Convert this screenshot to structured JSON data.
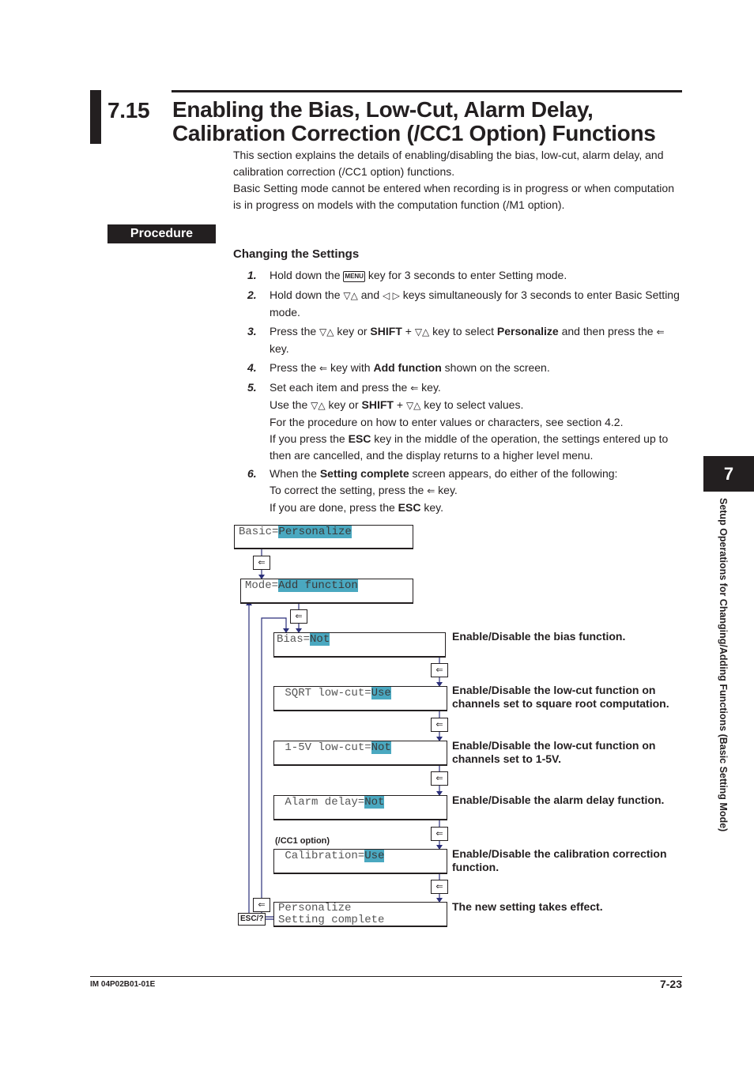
{
  "header": {
    "section_number": "7.15",
    "title_line1": "Enabling the Bias, Low-Cut, Alarm Delay,",
    "title_line2": "Calibration Correction (/CC1 Option) Functions"
  },
  "intro": {
    "line1": "This section explains the details of enabling/disabling the bias, low-cut, alarm delay, and calibration correction (/CC1 option) functions.",
    "line2": "Basic Setting mode cannot be entered when recording is in progress or when computation is in progress on models with the computation function (/M1 option)."
  },
  "procedure_label": "Procedure",
  "subheading": "Changing the Settings",
  "keys": {
    "menu": "MENU",
    "updown": "▽△",
    "leftright": "◁ ▷",
    "enter": "⇐",
    "shift": "SHIFT",
    "esc": "ESC"
  },
  "steps": [
    {
      "num": "1.",
      "a": "Hold down the ",
      "b": " key for 3 seconds to enter Setting mode."
    },
    {
      "num": "2.",
      "a": "Hold down the ",
      "b": " and ",
      "c": " keys simultaneously for 3 seconds to enter Basic Setting mode."
    },
    {
      "num": "3.",
      "a": "Press the ",
      "b": " key or ",
      "c": " + ",
      "d": " key to select ",
      "e": "Personalize",
      "f": " and then press the ",
      "g": " key."
    },
    {
      "num": "4.",
      "a": "Press the ",
      "b": " key with ",
      "c": "Add function",
      "d": " shown on the screen."
    },
    {
      "num": "5.",
      "a": "Set each item and press the ",
      "b": " key.",
      "c": "Use the ",
      "d": " key or ",
      "e": " + ",
      "f": " key to select values.",
      "g": "For the procedure on how to enter values or characters, see section 4.2.",
      "h": "If you press the ",
      "i": " key in the middle of the operation, the settings entered up to then are cancelled, and the display returns to a higher level menu."
    },
    {
      "num": "6.",
      "a": "When the ",
      "b": "Setting complete",
      "c": " screen appears, do either of the following:",
      "d": "To correct the setting, press the ",
      "e": " key.",
      "f": "If you are done, press the ",
      "g": " key."
    }
  ],
  "diagram": {
    "basic": {
      "label": "Basic=",
      "value": "Personalize"
    },
    "mode": {
      "label": "Mode=",
      "value": "Add function"
    },
    "items": [
      {
        "label": "Bias=",
        "value": "Not",
        "desc": "Enable/Disable the bias function."
      },
      {
        "label": " SQRT low-cut=",
        "value": "Use",
        "desc": "Enable/Disable the low-cut function on channels set to square root computation."
      },
      {
        "label": " 1-5V low-cut=",
        "value": "Not",
        "desc": "Enable/Disable the low-cut function on channels set to 1-5V."
      },
      {
        "label": " Alarm delay=",
        "value": "Not",
        "desc": "Enable/Disable the alarm delay function."
      },
      {
        "label": " Calibration=",
        "value": "Use",
        "desc": "Enable/Disable the calibration correction function.",
        "note": "(/CC1 option)"
      }
    ],
    "complete": {
      "line1": "Personalize",
      "line2": "Setting complete",
      "desc": "The new setting takes effect."
    },
    "esc_key": "ESC/?",
    "highlight_color": "#4aa8c0",
    "line_color": "#2b2f7a"
  },
  "side_tab": {
    "number": "7",
    "text": "Setup Operations for Changing/Adding Functions (Basic Setting Mode)"
  },
  "footer": {
    "doc_id": "IM 04P02B01-01E",
    "page": "7-23"
  }
}
